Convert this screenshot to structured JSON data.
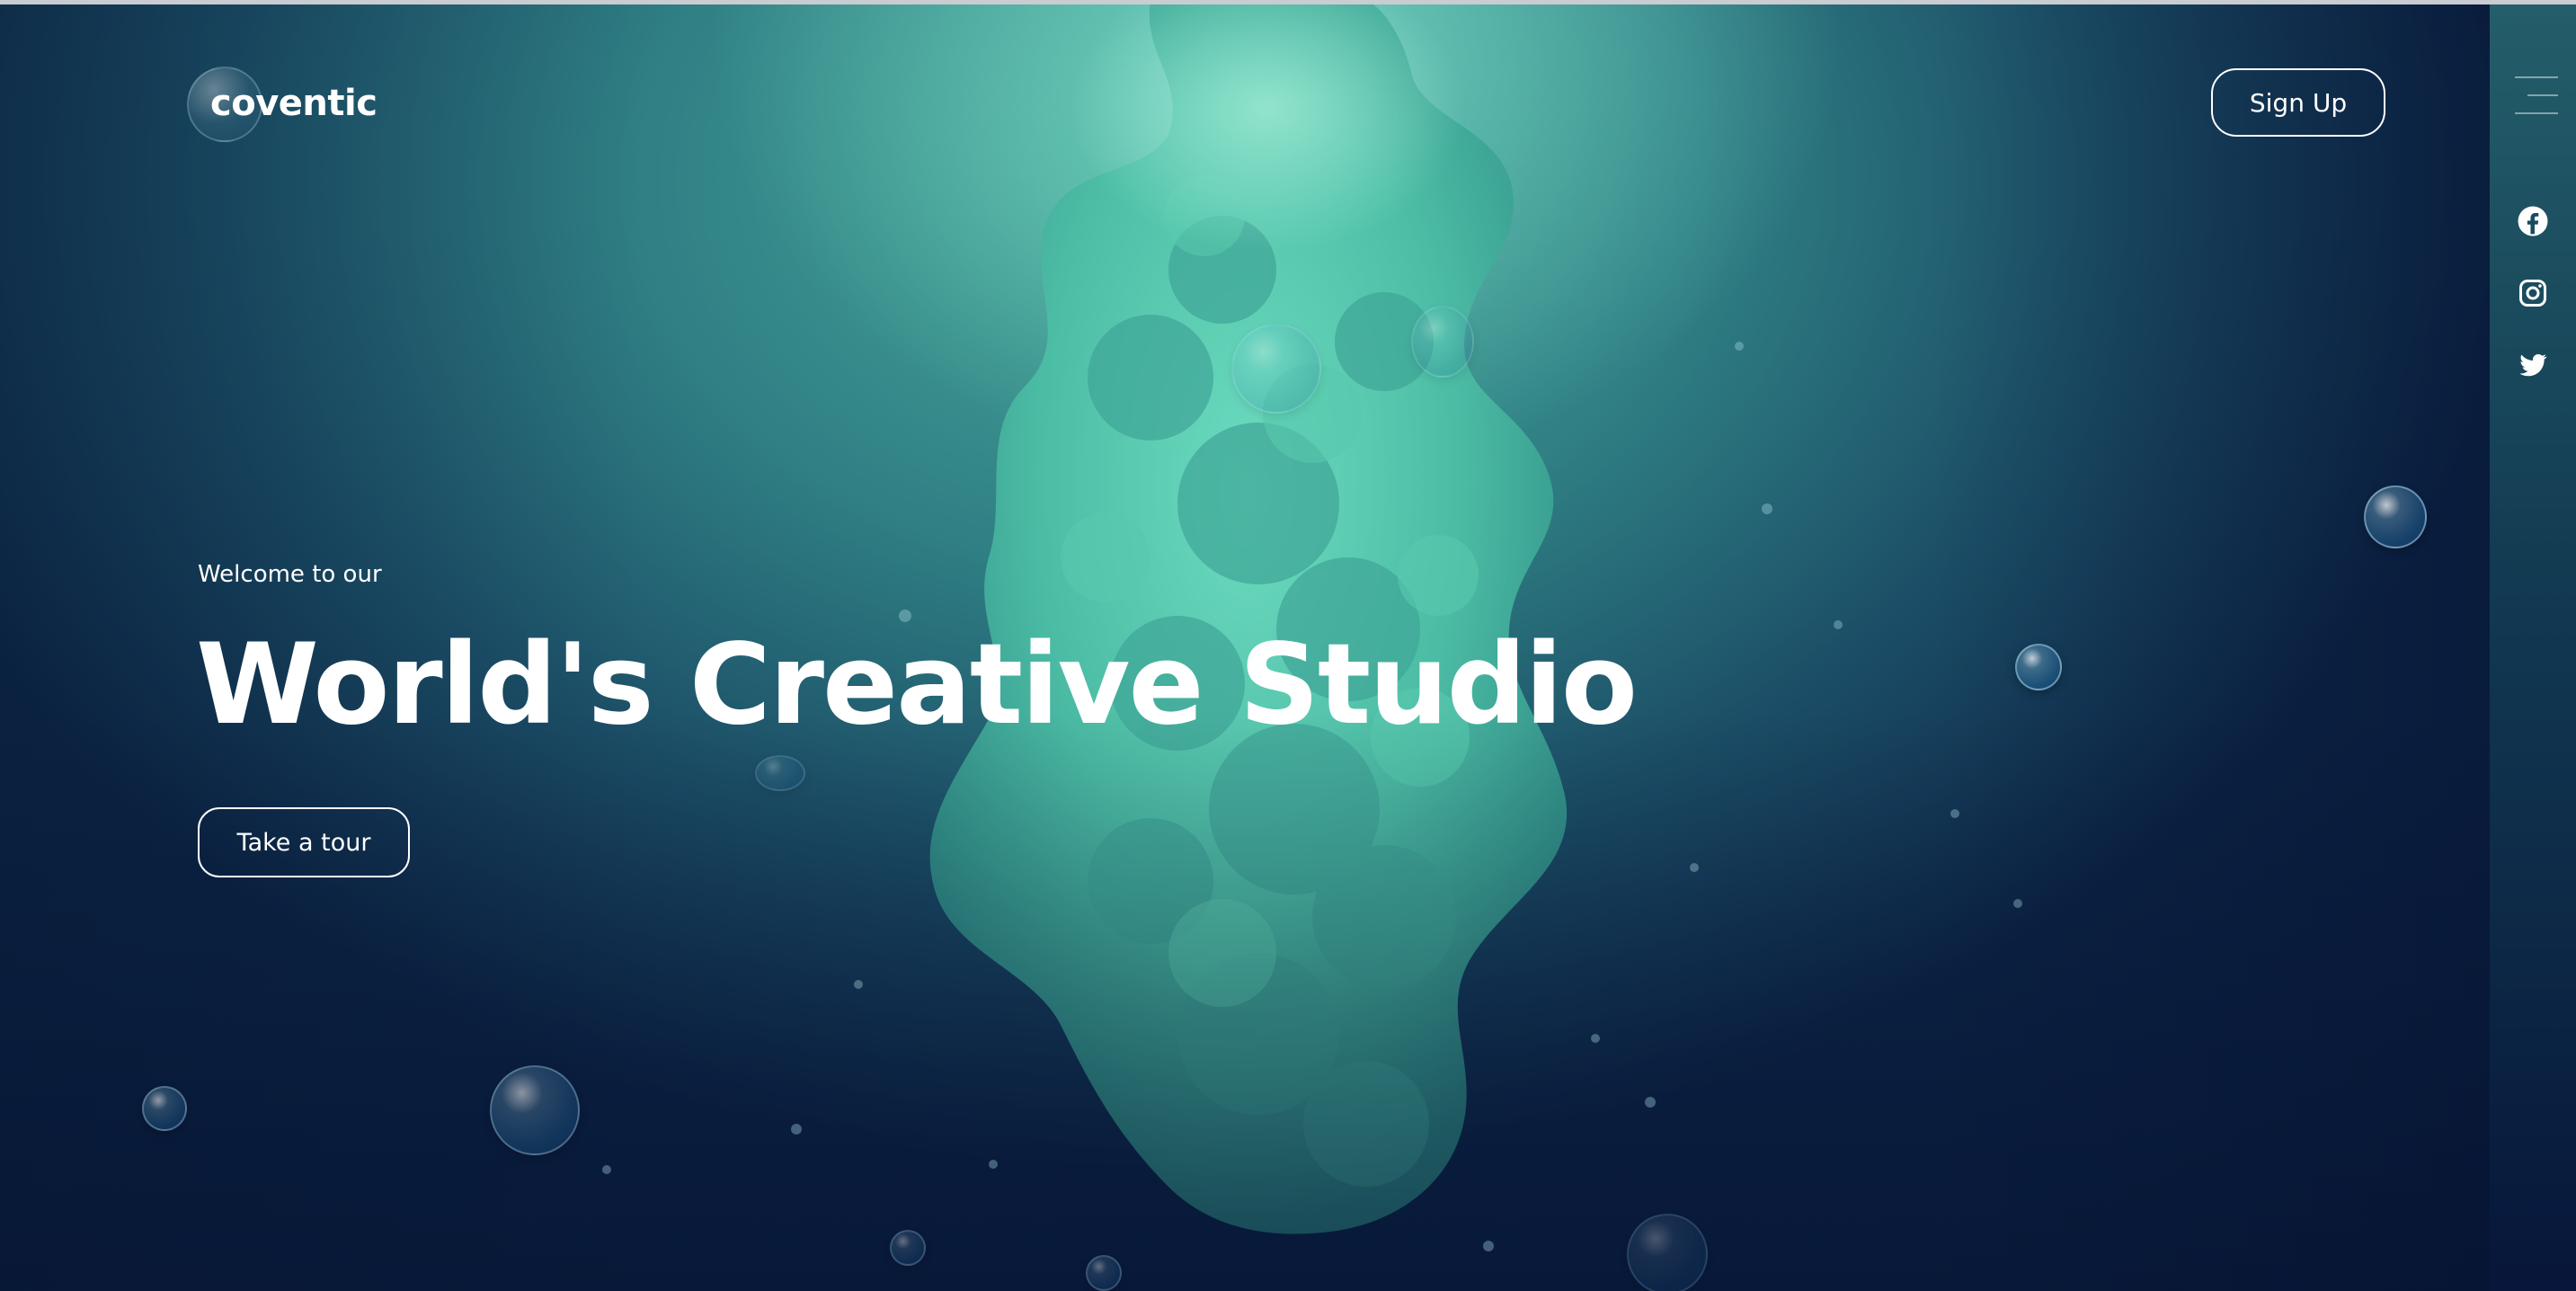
{
  "header": {
    "logo_text": "coventic",
    "signup_label": "Sign Up"
  },
  "sidebar": {
    "menu_icon": "hamburger-menu-icon",
    "social": [
      {
        "name": "facebook",
        "icon": "facebook-icon"
      },
      {
        "name": "instagram",
        "icon": "instagram-icon"
      },
      {
        "name": "twitter",
        "icon": "twitter-icon"
      }
    ]
  },
  "hero": {
    "kicker": "Welcome to our",
    "title": "World's Creative Studio",
    "cta_label": "Take a tour"
  },
  "colors": {
    "background_top": "#4aa99a",
    "background_bottom": "#0c2446",
    "ink": "#5fd0b4",
    "text": "#ffffff",
    "sidebar_top": "#245e6a",
    "sidebar_bottom": "#07163a"
  }
}
